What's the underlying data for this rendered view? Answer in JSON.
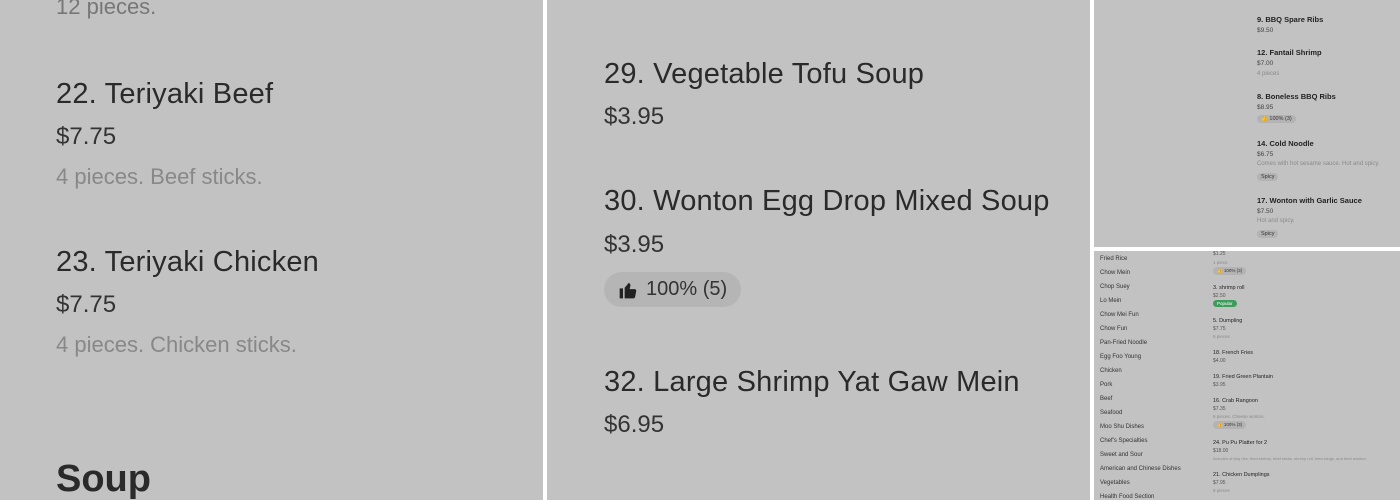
{
  "panel1": {
    "top_faded": "12 pieces.",
    "items": [
      {
        "name": "22. Teriyaki Beef",
        "price": "$7.75",
        "desc": "4 pieces. Beef sticks."
      },
      {
        "name": "23. Teriyaki Chicken",
        "price": "$7.75",
        "desc": "4 pieces. Chicken sticks."
      }
    ],
    "section": "Soup"
  },
  "panel2": {
    "items": [
      {
        "name": "29. Vegetable Tofu Soup",
        "price": "$3.95"
      },
      {
        "name": "30. Wonton Egg Drop Mixed Soup",
        "price": "$3.95",
        "rating": "100% (5)"
      },
      {
        "name": "32. Large Shrimp Yat Gaw Mein",
        "price": "$6.95"
      }
    ]
  },
  "panel3": {
    "items": [
      {
        "name": "9. BBQ Spare Ribs",
        "price": "$9.50"
      },
      {
        "name": "12. Fantail Shrimp",
        "price": "$7.00",
        "desc": "4 pieces"
      },
      {
        "name": "8. Boneless BBQ Ribs",
        "price": "$8.95",
        "rating": "100% (3)"
      },
      {
        "name": "14. Cold Noodle",
        "price": "$6.75",
        "desc": "Comes with hot sesame sauce. Hot and spicy.",
        "badge": "Spicy"
      },
      {
        "name": "17. Wonton with Garlic Sauce",
        "price": "$7.50",
        "desc": "Hot and spicy.",
        "badge": "Spicy"
      }
    ]
  },
  "panel4": {
    "nav": [
      "Fried Rice",
      "Chow Mein",
      "Chop Suey",
      "Lo Mein",
      "Chow Mei Fun",
      "Chow Fun",
      "Pan-Fried Noodle",
      "Egg Foo Young",
      "Chicken",
      "Pork",
      "Beef",
      "Seafood",
      "Moo Shu Dishes",
      "Chef's Specialties",
      "Sweet and Sour",
      "American and Chinese Dishes",
      "Vegetables",
      "Health Food Section"
    ],
    "top_partial": {
      "price": "$1.25",
      "desc": "1 piece",
      "rating": "100% (3)"
    },
    "items": [
      {
        "name": "3. shrimp roll",
        "price": "$2.50",
        "badge": "Popular"
      },
      {
        "name": "5. Dumpling",
        "price": "$7.75",
        "desc": "8 pieces"
      },
      {
        "name": "18. French Fries",
        "price": "$4.00"
      },
      {
        "name": "19. Fried Green Plantain",
        "price": "$3.95"
      },
      {
        "name": "16. Crab Rangoon",
        "price": "$7.35",
        "desc": "8 pieces. Cheese wonton.",
        "rating": "100% (3)"
      },
      {
        "name": "24. Pu Pu Platter for 2",
        "price": "$18.00",
        "desc": "Includes of bbq ribs, fried shrimp, beef sticks, shrimp roll, fried wings, and fried wonton."
      },
      {
        "name": "21. Chicken Dumplings",
        "price": "$7.95",
        "desc": "8 pieces"
      }
    ]
  },
  "colors": {
    "panel_bg": "#c2c2c2",
    "popular_badge": "#3e9b5c"
  }
}
